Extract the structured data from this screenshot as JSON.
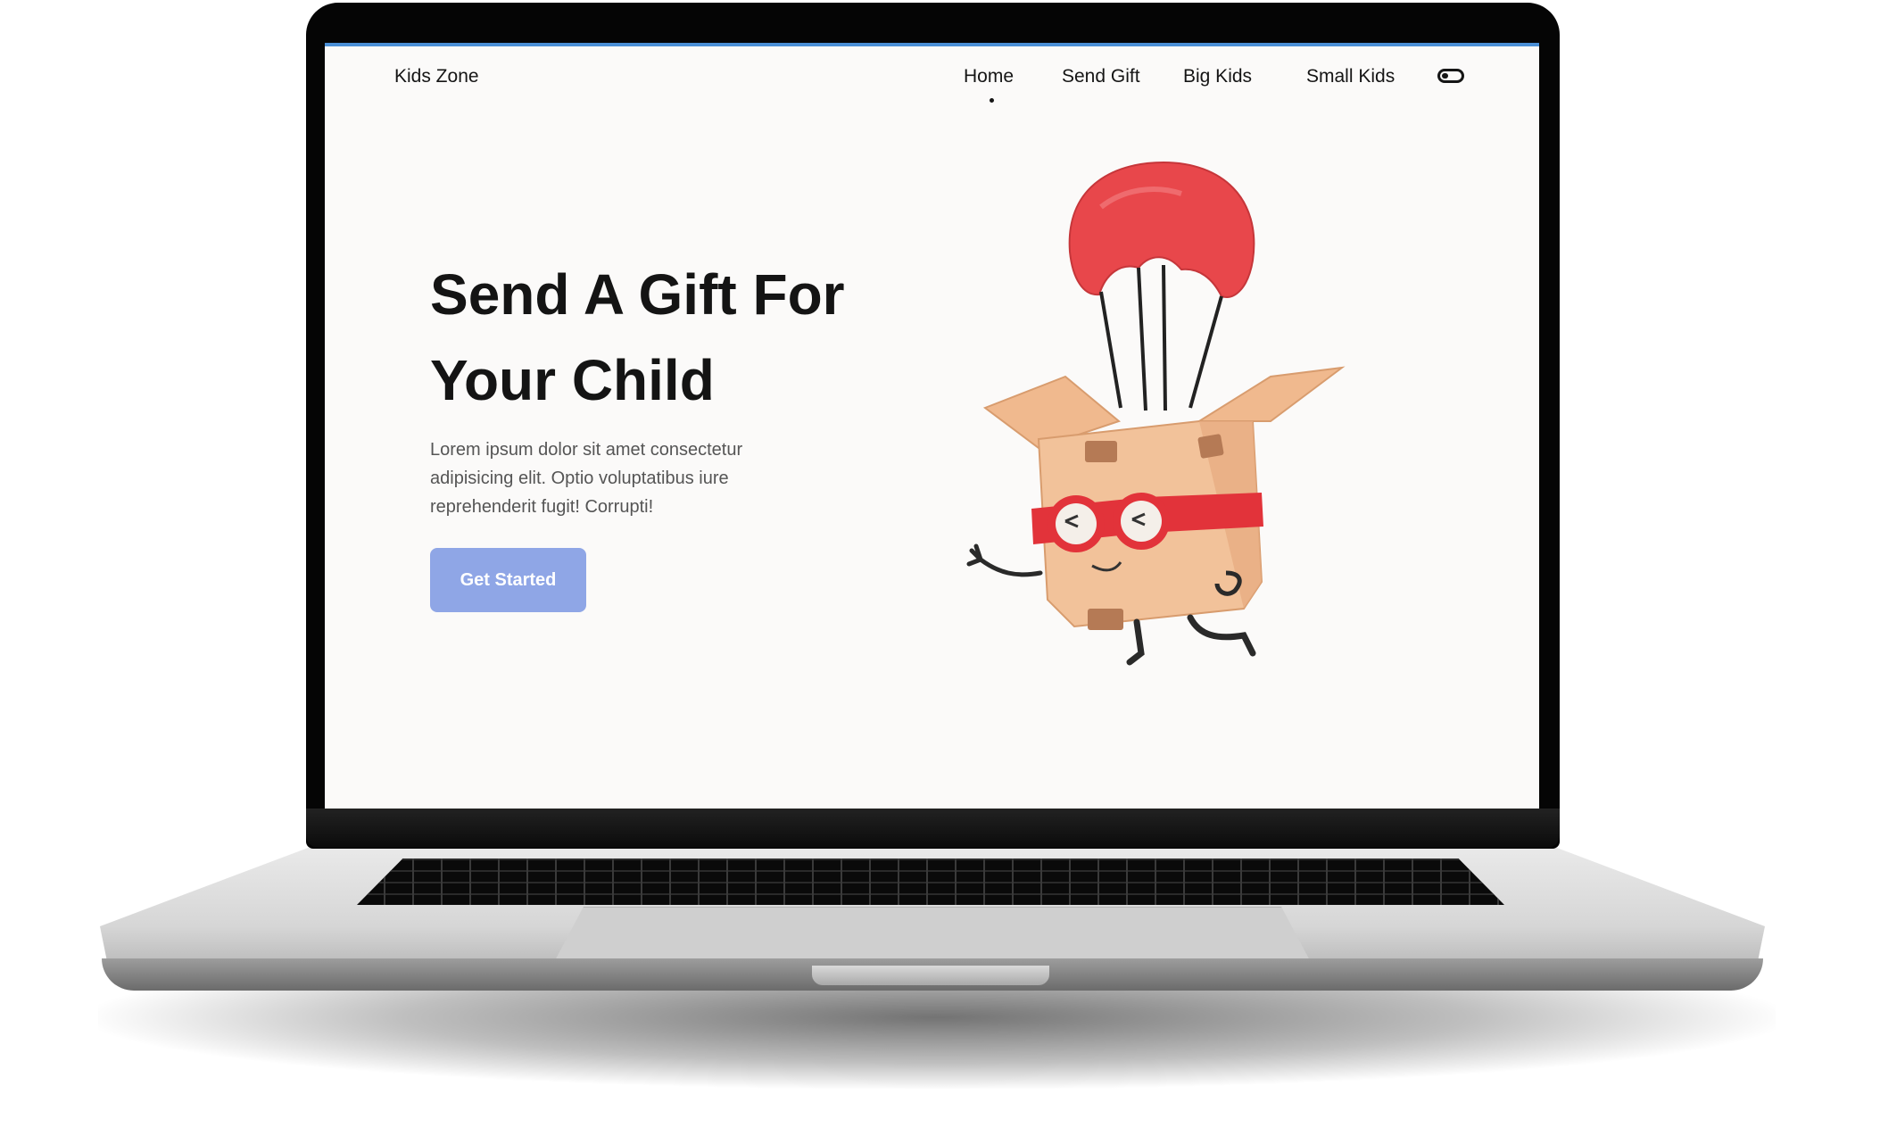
{
  "site": {
    "brand": "Kids Zone"
  },
  "nav": {
    "items": [
      {
        "label": "Home",
        "active": true
      },
      {
        "label": "Send Gift",
        "active": false
      },
      {
        "label": "Big Kids",
        "active": false
      },
      {
        "label": "Small Kids",
        "active": false
      }
    ],
    "theme_toggle_icon": "toggle-switch-icon"
  },
  "hero": {
    "title_line1": "Send A Gift For",
    "title_line2": "Your Child",
    "description": "Lorem ipsum dolor sit amet consectetur adipisicing elit. Optio voluptatibus iure reprehenderit fugit! Corrupti!",
    "cta_label": "Get Started",
    "illustration": "parachute-gift-box-character"
  },
  "colors": {
    "accent_bar": "#4a8fd6",
    "button": "#8fa6e6",
    "parachute": "#e8474b",
    "box": "#f2c29a",
    "goggles": "#e2333a"
  }
}
